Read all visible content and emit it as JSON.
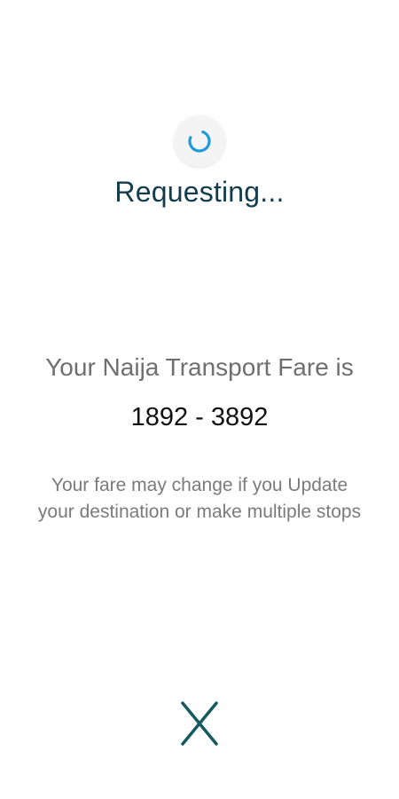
{
  "request": {
    "status_text": "Requesting...",
    "spinner_icon": "loading-spinner-icon"
  },
  "fare": {
    "label": "Your Naija Transport Fare is",
    "range": "1892 - 3892",
    "note": "Your fare may change if you Update your destination or make multiple stops"
  },
  "cancel": {
    "icon": "close-icon"
  },
  "colors": {
    "spinner": "#1e9bd7",
    "status_text": "#133b4e",
    "cancel_icon": "#155a5f"
  }
}
